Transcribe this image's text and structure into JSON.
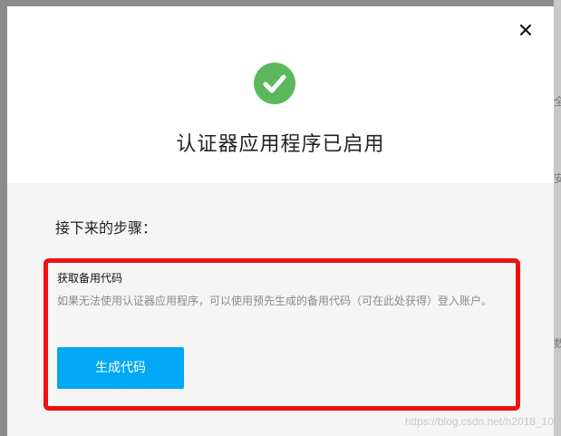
{
  "dialog": {
    "title": "认证器应用程序已启用",
    "next_steps_heading": "接下来的步骤：",
    "step": {
      "title": "获取备用代码",
      "description": "如果无法使用认证器应用程序，可以使用预先生成的备用代码（可在此处获得）登入账户。",
      "button_label": "生成代码"
    }
  },
  "background_fragments": [
    "全",
    "安",
    "数"
  ],
  "watermark": "https://blog.csdn.net/h2018_10",
  "colors": {
    "success": "#5cb85c",
    "primary_button": "#03a9f4",
    "highlight_border": "#ee1111"
  },
  "icons": [
    "close-icon",
    "check-circle-icon"
  ]
}
